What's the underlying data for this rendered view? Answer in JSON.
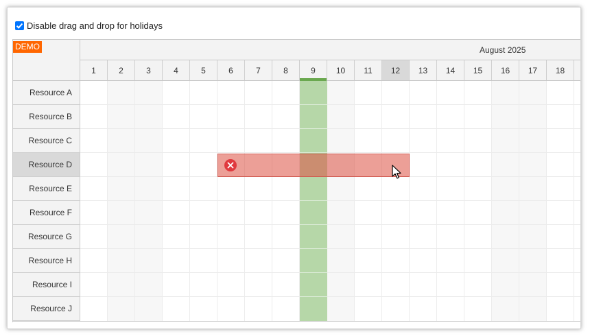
{
  "toolbar": {
    "checkbox_label": "Disable drag and drop for holidays",
    "checked": true
  },
  "scheduler": {
    "badge": "DEMO",
    "month": "August 2025",
    "days": [
      "1",
      "2",
      "3",
      "4",
      "5",
      "6",
      "7",
      "8",
      "9",
      "10",
      "11",
      "12",
      "13",
      "14",
      "15",
      "16",
      "17",
      "18"
    ],
    "weekend_days": [
      "2",
      "3",
      "9",
      "10",
      "16",
      "17"
    ],
    "holiday_day": "9",
    "selected_day": "12",
    "resources": [
      "Resource A",
      "Resource B",
      "Resource C",
      "Resource D",
      "Resource E",
      "Resource F",
      "Resource G",
      "Resource H",
      "Resource I",
      "Resource J"
    ],
    "selected_resource": "Resource D",
    "drag_shadow": {
      "resource": "Resource D",
      "start_day": "6",
      "end_day": "12",
      "state": "forbidden",
      "icon": "error-x-icon"
    }
  },
  "colors": {
    "holiday": "#b6d7a8",
    "holiday_bar": "#6aa84f",
    "forbidden_shadow": "#dc5041",
    "badge": "#ff6600",
    "header_bg": "#f3f3f3"
  }
}
